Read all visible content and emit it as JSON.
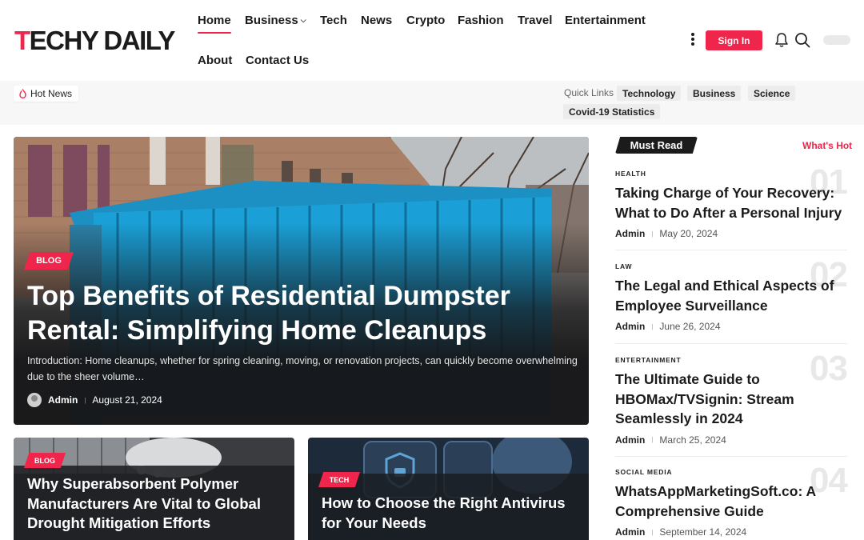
{
  "brand": {
    "logo_first": "T",
    "logo_rest": "ECHY DAILY"
  },
  "nav": {
    "items": [
      {
        "label": "Home",
        "active": true
      },
      {
        "label": "Business",
        "has_dropdown": true
      },
      {
        "label": "Tech"
      },
      {
        "label": "News"
      },
      {
        "label": "Crypto"
      },
      {
        "label": "Fashion"
      },
      {
        "label": "Travel"
      },
      {
        "label": "Entertainment"
      },
      {
        "label": "About"
      },
      {
        "label": "Contact Us"
      }
    ],
    "dropdown_caret": "⌄",
    "signin_label": "Sign In"
  },
  "subbar": {
    "hot_news_label": "Hot News",
    "quick_links_label": "Quick Links",
    "quick_links": [
      "Technology",
      "Business",
      "Science",
      "Covid-19 Statistics"
    ]
  },
  "hero": {
    "badge": "Blog",
    "title": "Top Benefits of Residential Dumpster Rental: Simplifying Home Cleanups",
    "excerpt": "Introduction: Home cleanups, whether for spring cleaning, moving, or renovation projects, can quickly become overwhelming due to the sheer volume…",
    "author": "Admin",
    "date": "August 21, 2024"
  },
  "cards": [
    {
      "badge": "Blog",
      "title": "Why Superabsorbent Polymer Manufacturers Are Vital to Global Drought Mitigation Efforts"
    },
    {
      "badge": "Tech",
      "title": "How to Choose the Right Antivirus for Your Needs"
    }
  ],
  "sidebar": {
    "must_read_label": "Must Read",
    "whats_hot_label": "What's Hot",
    "items": [
      {
        "num": "01",
        "category": "HEALTH",
        "title": "Taking Charge of Your Recovery: What to Do After a Personal Injury",
        "author": "Admin",
        "date": "May 20, 2024"
      },
      {
        "num": "02",
        "category": "LAW",
        "title": "The Legal and Ethical Aspects of Employee Surveillance",
        "author": "Admin",
        "date": "June 26, 2024"
      },
      {
        "num": "03",
        "category": "ENTERTAINMENT",
        "title": "The Ultimate Guide to HBOMax/TVSignin: Stream Seamlessly in 2024",
        "author": "Admin",
        "date": "March 25, 2024"
      },
      {
        "num": "04",
        "category": "SOCIAL MEDIA",
        "title": "WhatsAppMarketingSoft.co: A Comprehensive Guide",
        "author": "Admin",
        "date": "September 14, 2024"
      }
    ]
  },
  "colors": {
    "accent": "#f0254b",
    "dark": "#1b1b1b",
    "subbar_bg": "#f7f7f7"
  },
  "icons": [
    "more-vertical-icon",
    "bell-icon",
    "search-icon",
    "fire-icon"
  ]
}
